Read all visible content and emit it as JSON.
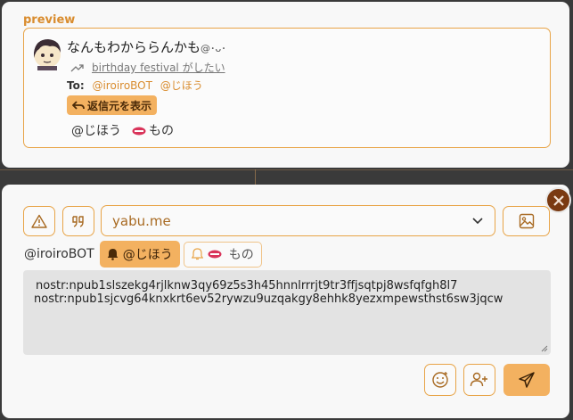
{
  "preview": {
    "title": "preview",
    "note_text": "なんもわかららんかも",
    "note_text_display": "なんもわかららんかも",
    "note_emoji_suffix": "@･ᴗ･",
    "reply_link": "birthday festival がしたい",
    "to_label": "To:",
    "to_mentions": [
      "@iroiroBOT",
      "@じほう"
    ],
    "show_source_label": "返信元を表示",
    "tags": [
      "@じほう",
      "もの"
    ]
  },
  "composer": {
    "relay_value": "yabu.me",
    "mention_plain": "@iroiroBOT",
    "mention_chip_active": "@じほう",
    "mention_chip": "もの",
    "content_lines": [
      "nostr:npub1slszekg4rjlknw3qy69z5s3h45hnnlrrrjt9tr3ffjsqtpj8wsfqfgh8l7",
      "nostr:npub1sjcvg64knxkrt6ev52rywzu9uzqakgy8ehhk8yezxmpewsthst6sw3jqcw"
    ]
  },
  "colors": {
    "accent": "#e8a447",
    "accent_fill": "#f3b160",
    "close_bg": "#7a3a12"
  },
  "icons": {
    "warning": "warning-icon",
    "quote": "quote-icon",
    "image": "image-icon",
    "emoji": "emoji-icon",
    "add_user": "add-user-icon",
    "send": "send-icon",
    "close": "close-icon",
    "bell": "bell-icon"
  }
}
